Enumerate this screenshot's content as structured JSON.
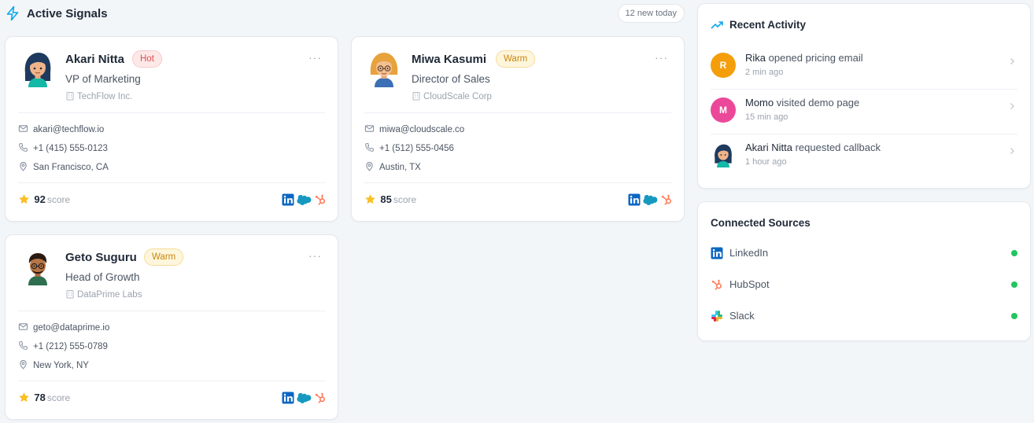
{
  "header": {
    "title": "Active Signals",
    "new_today": "12 new today"
  },
  "cards": [
    {
      "name": "Akari Nitta",
      "badge": "Hot",
      "role": "VP of Marketing",
      "company": "TechFlow Inc.",
      "email": "akari@techflow.io",
      "phone": "+1 (415) 555-0123",
      "location": "San Francisco, CA",
      "score": "92",
      "score_label": "score"
    },
    {
      "name": "Miwa Kasumi",
      "badge": "Warm",
      "role": "Director of Sales",
      "company": "CloudScale Corp",
      "email": "miwa@cloudscale.co",
      "phone": "+1 (512) 555-0456",
      "location": "Austin, TX",
      "score": "85",
      "score_label": "score"
    },
    {
      "name": "Geto Suguru",
      "badge": "Warm",
      "role": "Head of Growth",
      "company": "DataPrime Labs",
      "email": "geto@dataprime.io",
      "phone": "+1 (212) 555-0789",
      "location": "New York, NY",
      "score": "78",
      "score_label": "score"
    }
  ],
  "recent": {
    "title": "Recent Activity",
    "items": [
      {
        "initial": "R",
        "who": "Rika",
        "action": "opened pricing email",
        "when": "2 min ago",
        "color": "#f59e0b"
      },
      {
        "initial": "M",
        "who": "Momo",
        "action": "visited demo page",
        "when": "15 min ago",
        "color": "#ec4899"
      },
      {
        "initial": "",
        "who": "Akari Nitta",
        "action": "requested callback",
        "when": "1 hour ago",
        "color": ""
      }
    ]
  },
  "sources": {
    "title": "Connected Sources",
    "items": [
      {
        "name": "LinkedIn",
        "icon": "linkedin-icon"
      },
      {
        "name": "HubSpot",
        "icon": "hubspot-icon"
      },
      {
        "name": "Slack",
        "icon": "slack-icon"
      }
    ]
  },
  "colors": {
    "accent": "#0ea5e9",
    "hot": "#e0524f",
    "warm": "#c9850f",
    "connected": "#22c55e",
    "linkedin": "#0a66c2",
    "salesforce": "#1798c1",
    "hubspot": "#ff7a59"
  }
}
